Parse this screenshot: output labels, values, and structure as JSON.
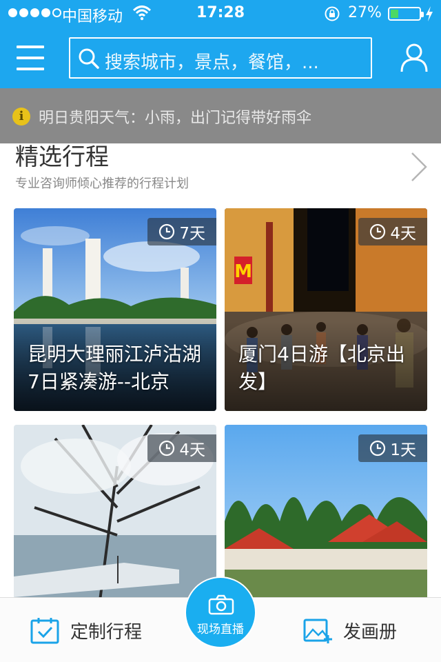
{
  "status_bar": {
    "carrier": "中国移动",
    "time": "17:28",
    "battery_percent_label": "27%",
    "battery_level": 0.27
  },
  "header": {
    "search_placeholder": "搜索城市，景点，餐馆，..."
  },
  "notice": {
    "text": "明日贵阳天气：小雨，出门记得带好雨伞"
  },
  "section": {
    "title": "精选行程",
    "subtitle": "专业咨询师倾心推荐的行程计划"
  },
  "cards": [
    {
      "duration": "7天",
      "title": "昆明大理丽江泸沽湖7日紧凑游--北京"
    },
    {
      "duration": "4天",
      "title": "厦门4日游【北京出发】"
    },
    {
      "duration": "4天",
      "title": ""
    },
    {
      "duration": "1天",
      "title": ""
    }
  ],
  "tabbar": {
    "custom_trip": "定制行程",
    "live": "现场直播",
    "post": "发画册"
  },
  "colors": {
    "brand_blue": "#1da7ef",
    "battery_green": "#4cd964"
  }
}
